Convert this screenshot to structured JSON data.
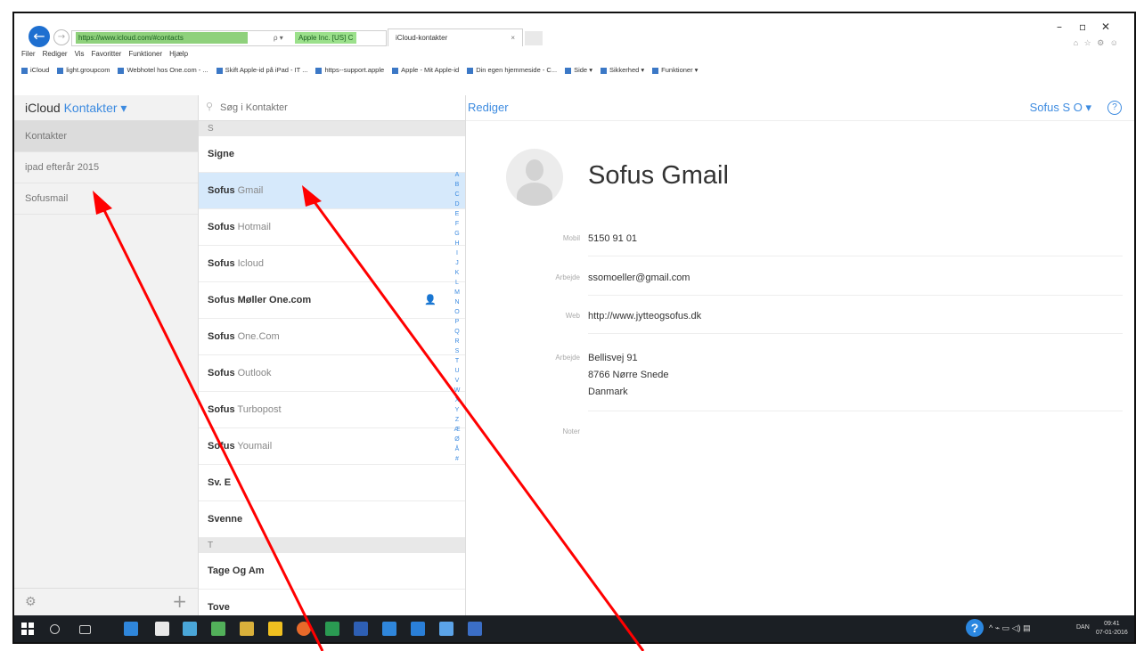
{
  "browser": {
    "url": "https://www.icloud.com/#contacts",
    "search_glyph": "ρ ▾",
    "cert_label": "Apple Inc. [US] C",
    "tab_title": "iCloud-kontakter",
    "tab_close": "×",
    "minimize": "–",
    "restore": "▫",
    "close": "✕",
    "menu": [
      "Filer",
      "Rediger",
      "Vis",
      "Favoritter",
      "Funktioner",
      "Hjælp"
    ],
    "favorites": [
      "iCloud",
      "light.groupcom",
      "Webhotel hos One.com - ...",
      "Skift Apple-id på iPad - IT ...",
      "https--support.apple",
      "Apple - Mit Apple-id",
      "Din egen hjemmeside - C...",
      "Side ▾",
      "Sikkerhed ▾",
      "Funktioner ▾"
    ]
  },
  "sidebar": {
    "brand": "iCloud",
    "section": "Kontakter ▾",
    "groups": [
      {
        "label": "Kontakter",
        "active": true
      },
      {
        "label": "ipad efterår 2015",
        "active": false
      },
      {
        "label": "Sofusmail",
        "active": false
      }
    ],
    "settings_icon": "⚙",
    "add_icon": "+"
  },
  "list": {
    "search_placeholder": "Søg i Kontakter",
    "rows": [
      {
        "type": "letter",
        "text": "S"
      },
      {
        "type": "contact",
        "first": "Signe",
        "last": ""
      },
      {
        "type": "contact",
        "first": "Sofus",
        "last": "Gmail",
        "selected": true
      },
      {
        "type": "contact",
        "first": "Sofus",
        "last": "Hotmail"
      },
      {
        "type": "contact",
        "first": "Sofus",
        "last": "Icloud"
      },
      {
        "type": "contact",
        "first": "Sofus Møller One.com",
        "last": "",
        "card": true
      },
      {
        "type": "contact",
        "first": "Sofus",
        "last": "One.Com"
      },
      {
        "type": "contact",
        "first": "Sofus",
        "last": "Outlook"
      },
      {
        "type": "contact",
        "first": "Sofus",
        "last": "Turbopost"
      },
      {
        "type": "contact",
        "first": "Sofus",
        "last": "Youmail"
      },
      {
        "type": "contact",
        "first": "Sv. E",
        "last": ""
      },
      {
        "type": "contact",
        "first": "Svenne",
        "last": ""
      },
      {
        "type": "letter",
        "text": "T"
      },
      {
        "type": "contact",
        "first": "Tage Og Am",
        "last": ""
      },
      {
        "type": "contact",
        "first": "Tove",
        "last": ""
      }
    ],
    "index_letters": [
      "A",
      "B",
      "C",
      "D",
      "E",
      "F",
      "G",
      "H",
      "I",
      "J",
      "K",
      "L",
      "M",
      "N",
      "O",
      "P",
      "Q",
      "R",
      "S",
      "T",
      "U",
      "V",
      "W",
      "X",
      "Y",
      "Z",
      "Æ",
      "Ø",
      "Å",
      "#"
    ]
  },
  "detail": {
    "edit_label": "Rediger",
    "user_menu": "Sofus S O ▾",
    "help": "?",
    "name": "Sofus Gmail",
    "fields": [
      {
        "label": "Mobil",
        "value": "5150 91 01"
      },
      {
        "label": "Arbejde",
        "value": "ssomoeller@gmail.com"
      },
      {
        "label": "Web",
        "value": "http://www.jytteogsofus.dk"
      },
      {
        "label": "Arbejde",
        "value": "Bellisvej 91\n8766 Nørre Snede\nDanmark"
      },
      {
        "label": "Noter",
        "value": ""
      }
    ]
  },
  "taskbar": {
    "help_icon": "?",
    "tray": "^ ⌁ ▭ ◁) ▤",
    "language": "DAN",
    "time": "09:41",
    "date": "07-01-2016"
  },
  "colors": {
    "accent": "#3d8be0",
    "selected_row": "#d6e9fb",
    "annotation_arrow": "#ff0000",
    "taskbar": "#1b1f24"
  }
}
